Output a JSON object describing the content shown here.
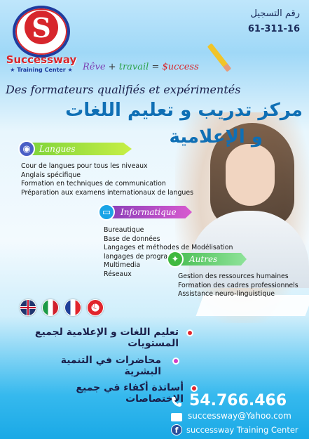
{
  "logo": {
    "name": "Successway",
    "subtitle": "★ Training Center ★",
    "letter": "S"
  },
  "registration": {
    "label": "رقم التسجيل",
    "number": "61-311-16"
  },
  "slogan": {
    "reve": "Rêve",
    "plus": "+",
    "travail": "travail",
    "equals": "=",
    "success": "$uccess"
  },
  "tagline": "Des formateurs qualifiés et expérimentés",
  "title": {
    "line1": "مركز تدريب و تعليم اللغات",
    "line2": "و الإعلامية"
  },
  "sections": {
    "langues": {
      "label": "Langues",
      "items": [
        "Cour de langues pour tous les niveaux",
        "Anglais spécifique",
        "Formation en techniques de communication",
        "Préparation aux examens  internationaux de langues"
      ]
    },
    "informatique": {
      "label": "Informatique",
      "items": [
        "Bureautique",
        "Base de données",
        "Langages et méthodes de Modélisation",
        "langages de programmation",
        "Multimedia",
        "Réseaux"
      ]
    },
    "autres": {
      "label": "Autres",
      "items": [
        "Gestion des ressources humaines",
        "Formation des cadres professionnels",
        "Assistance neuro-linguistique"
      ]
    }
  },
  "arabic_points": [
    "تعليم اللغات و الإعلامية لجميع المستويات",
    "محاضرات في التنمية البشرية",
    "أساتذة أكفاء في جميع الإختصاصات"
  ],
  "contact": {
    "phone": "54.766.466",
    "email": "successway@Yahoo.com",
    "facebook": "successway Training Center"
  },
  "colors": {
    "brand_red": "#d7262c",
    "brand_blue": "#1f3c9e",
    "title_blue": "#0f6fb5"
  }
}
